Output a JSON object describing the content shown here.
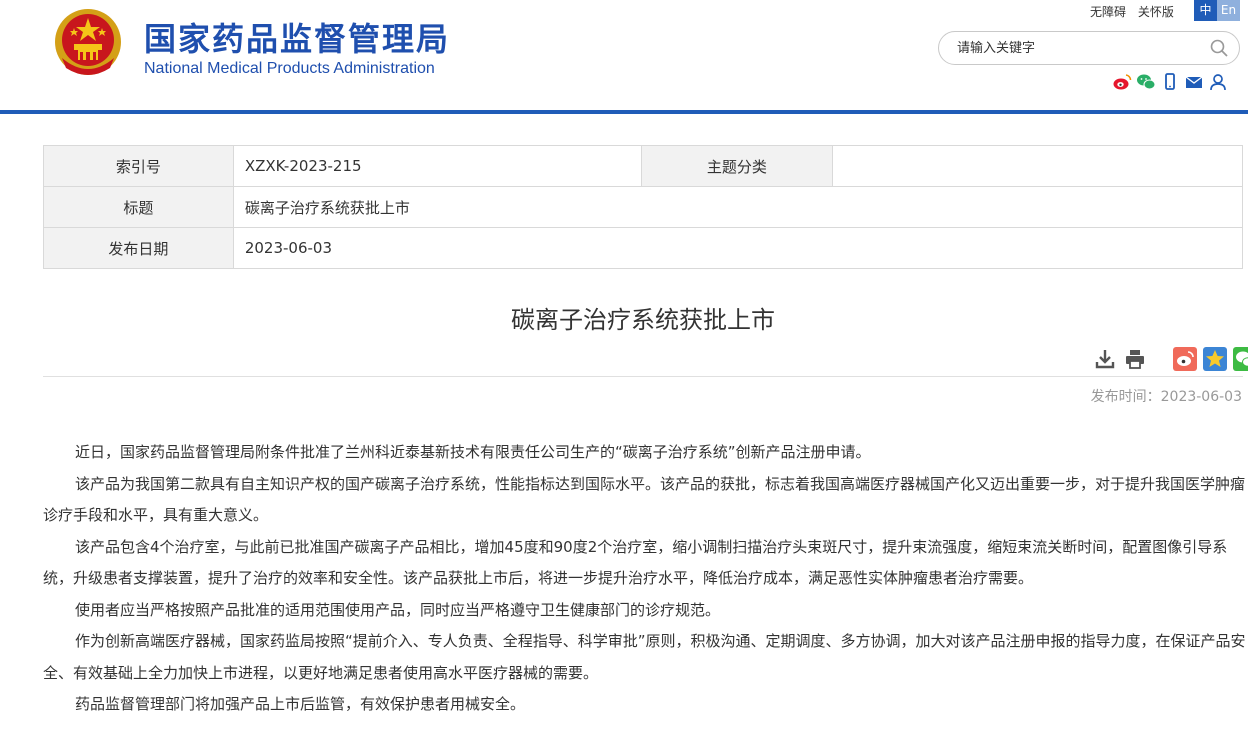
{
  "header": {
    "site_name_cn": "国家药品监督管理局",
    "site_name_en": "National Medical Products Administration",
    "top_links": [
      "无障碍",
      "关怀版"
    ],
    "lang_zh": "中",
    "lang_en": "En",
    "search_placeholder": "请输入关键字",
    "social_icons": [
      "weibo-icon",
      "wechat-icon",
      "mobile-icon",
      "mail-icon",
      "user-icon"
    ],
    "brand_color": "#1f5cb8"
  },
  "info": {
    "index_label": "索引号",
    "index_value": "XZXK-2023-215",
    "category_label": "主题分类",
    "category_value": "",
    "title_label": "标题",
    "title_value": "碳离子治疗系统获批上市",
    "date_label": "发布日期",
    "date_value": "2023-06-03"
  },
  "article": {
    "title": "碳离子治疗系统获批上市",
    "tool_icons": [
      "download-icon",
      "print-icon",
      "weibo-share-icon",
      "favorite-star-icon",
      "wechat-share-icon"
    ],
    "pub_time": "发布时间：2023-06-03",
    "paragraphs": [
      "近日，国家药品监督管理局附条件批准了兰州科近泰基新技术有限责任公司生产的“碳离子治疗系统”创新产品注册申请。",
      "该产品为我国第二款具有自主知识产权的国产碳离子治疗系统，性能指标达到国际水平。该产品的获批，标志着我国高端医疗器械国产化又迈出重要一步，对于提升我国医学肿瘤诊疗手段和水平，具有重大意义。",
      "该产品包含4个治疗室，与此前已批准国产碳离子产品相比，增加45度和90度2个治疗室，缩小调制扫描治疗头束斑尺寸，提升束流强度，缩短束流关断时间，配置图像引导系统，升级患者支撑装置，提升了治疗的效率和安全性。该产品获批上市后，将进一步提升治疗水平，降低治疗成本，满足恶性实体肿瘤患者治疗需要。",
      "使用者应当严格按照产品批准的适用范围使用产品，同时应当严格遵守卫生健康部门的诊疗规范。",
      "作为创新高端医疗器械，国家药监局按照“提前介入、专人负责、全程指导、科学审批”原则，积极沟通、定期调度、多方协调，加大对该产品注册申报的指导力度，在保证产品安全、有效基础上全力加快上市进程，以更好地满足患者使用高水平医疗器械的需要。",
      "药品监督管理部门将加强产品上市后监管，有效保护患者用械安全。"
    ]
  }
}
